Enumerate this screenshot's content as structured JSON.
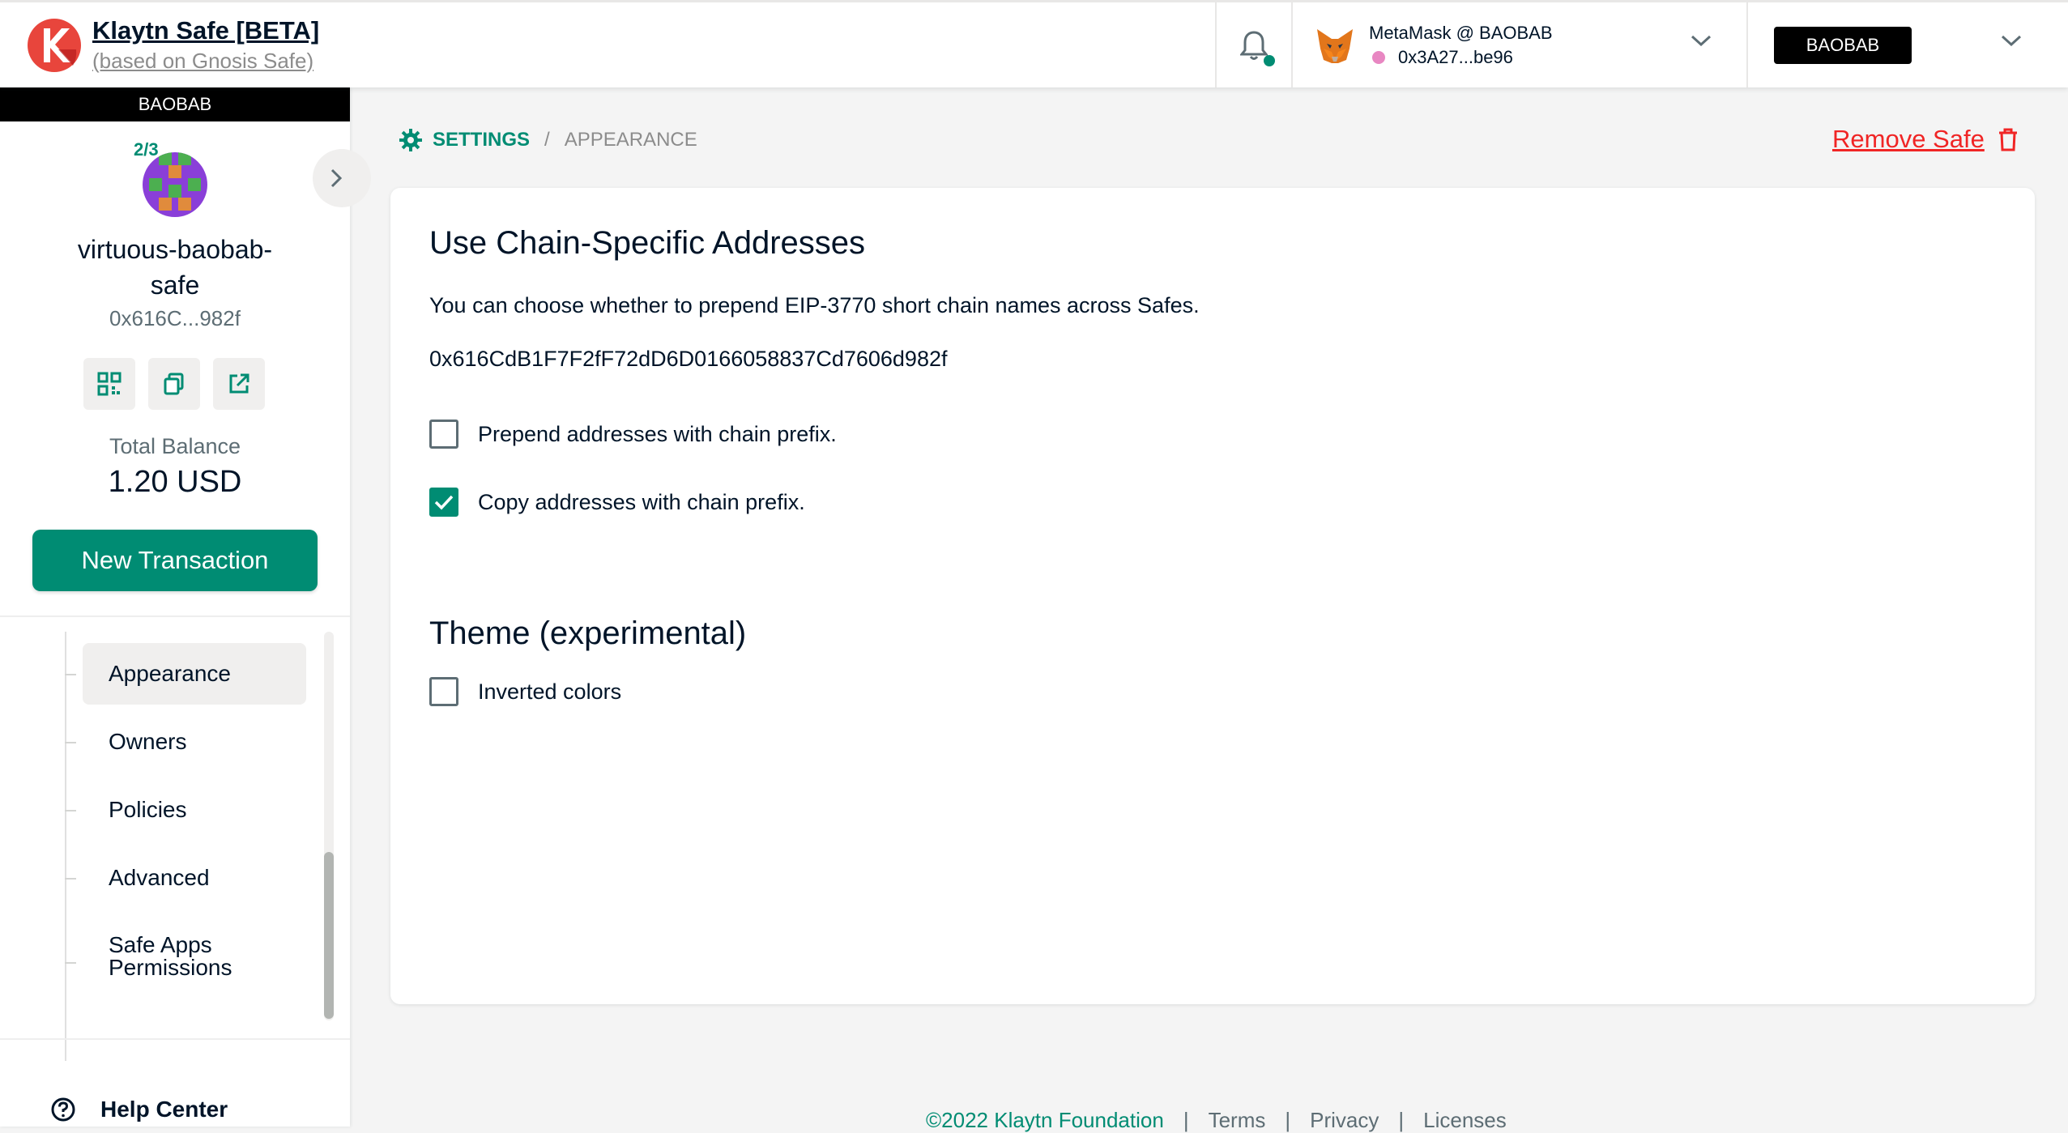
{
  "header": {
    "title": "Klaytn Safe [BETA]",
    "subtitle": "(based on Gnosis Safe)",
    "wallet_name": "MetaMask @ BAOBAB",
    "wallet_address": "0x3A27...be96",
    "network": "BAOBAB"
  },
  "sidebar": {
    "network_label": "BAOBAB",
    "threshold": "2/3",
    "safe_name": "virtuous-baobab-safe",
    "safe_address": "0x616C...982f",
    "balance_label": "Total Balance",
    "balance_value": "1.20 USD",
    "new_tx_label": "New Transaction",
    "items": [
      {
        "label": "Appearance",
        "active": true
      },
      {
        "label": "Owners",
        "active": false
      },
      {
        "label": "Policies",
        "active": false
      },
      {
        "label": "Advanced",
        "active": false
      },
      {
        "label": "Safe Apps Permissions",
        "active": false
      }
    ],
    "help_label": "Help Center"
  },
  "breadcrumb": {
    "section": "SETTINGS",
    "separator": "/",
    "current": "APPEARANCE"
  },
  "remove_safe_label": "Remove Safe",
  "card": {
    "section1_title": "Use Chain-Specific Addresses",
    "section1_desc": "You can choose whether to prepend EIP-3770 short chain names across Safes.",
    "address": "0x616CdB1F7F2fF72dD6D0166058837Cd7606d982f",
    "options": [
      {
        "label": "Prepend addresses with chain prefix.",
        "checked": false
      },
      {
        "label": "Copy addresses with chain prefix.",
        "checked": true
      }
    ],
    "section2_title": "Theme (experimental)",
    "theme_options": [
      {
        "label": "Inverted colors",
        "checked": false
      }
    ]
  },
  "footer": {
    "copyright": "©2022 Klaytn Foundation",
    "links": [
      "Terms",
      "Privacy",
      "Licenses"
    ]
  },
  "colors": {
    "accent": "#008c73",
    "danger": "#f02525",
    "text": "#001428"
  }
}
